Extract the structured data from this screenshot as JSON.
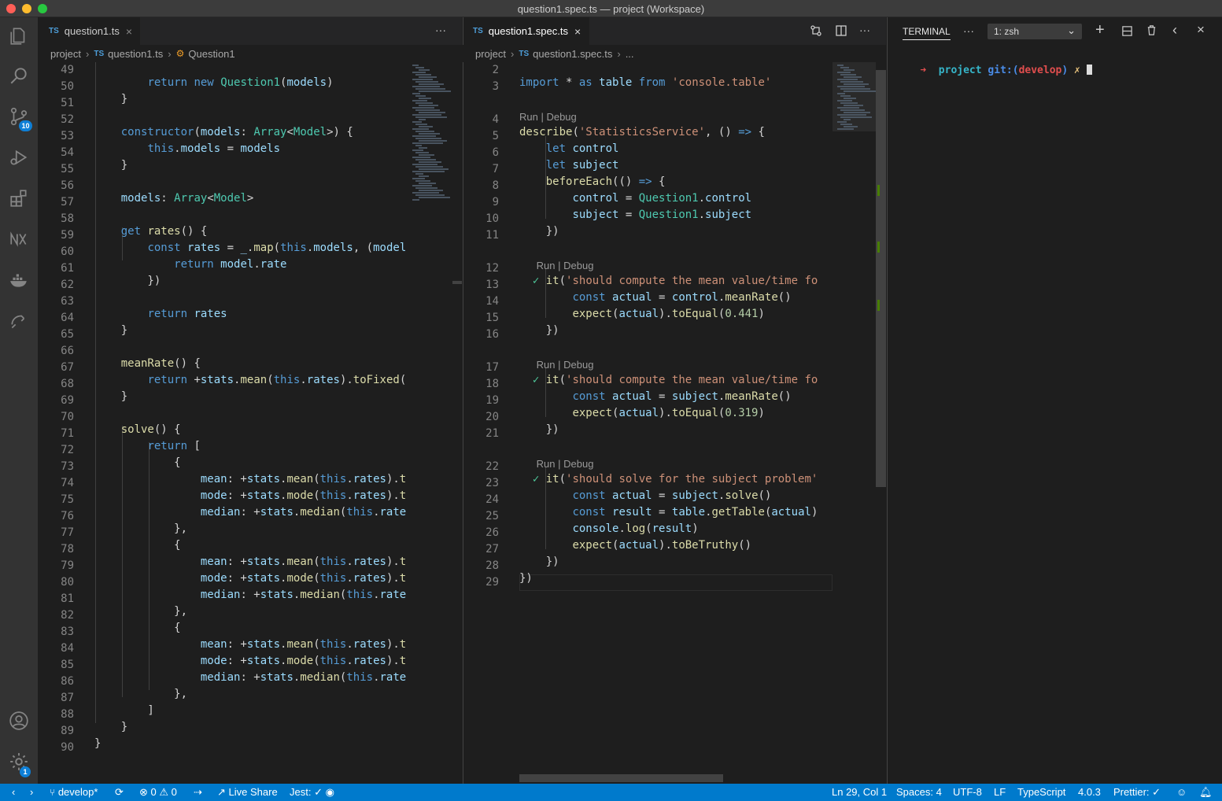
{
  "window": {
    "title": "question1.spec.ts — project (Workspace)"
  },
  "activity_bar": {
    "scm_badge": "10",
    "settings_badge": "1"
  },
  "left_editor": {
    "tab": "question1.ts",
    "breadcrumb": [
      "project",
      "question1.ts",
      "Question1"
    ],
    "first_line": 49
  },
  "right_editor": {
    "tab": "question1.spec.ts",
    "breadcrumb": [
      "project",
      "question1.spec.ts",
      "..."
    ],
    "codelens": "Run | Debug"
  },
  "terminal": {
    "tab": "TERMINAL",
    "shell_select": "1: zsh",
    "prompt_arrow": "➜",
    "prompt_dir": "project",
    "prompt_git": "git:(",
    "prompt_branch": "develop",
    "prompt_close": ")",
    "prompt_mark": "✗"
  },
  "status": {
    "branch": "develop*",
    "errors": "0",
    "warnings": "0",
    "live_share": "Live Share",
    "jest": "Jest: ✓",
    "position": "Ln 29, Col 1",
    "spaces": "Spaces: 4",
    "encoding": "UTF-8",
    "eol": "LF",
    "language": "TypeScript",
    "ts_version": "4.0.3",
    "prettier": "Prettier: ✓"
  },
  "colors": {
    "accent": "#007acc",
    "keyword": "#569cd6",
    "type": "#4ec9b0",
    "string": "#ce9178"
  }
}
